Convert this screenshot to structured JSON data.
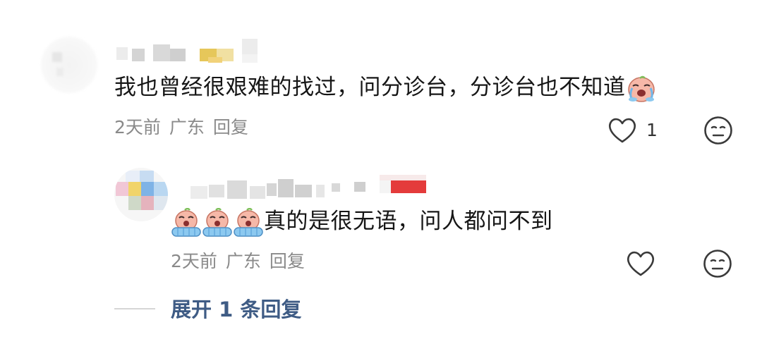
{
  "comments": [
    {
      "text": "我也曾经很艰难的找过，问分诊台，分诊台也不知道",
      "emoji_icon": "crying-baby-icon",
      "time": "2天前",
      "location": "广东",
      "reply_label": "回复",
      "like_count": "1"
    }
  ],
  "reply": {
    "emoji_icons": [
      "crying-baby-icon",
      "crying-baby-icon",
      "crying-baby-icon"
    ],
    "text": "真的是很无语，问人都问不到",
    "time": "2天前",
    "location": "广东",
    "reply_label": "回复"
  },
  "expand_replies_label": "展开 1 条回复",
  "colors": {
    "link": "#3f5c85",
    "meta": "#8a8a8a",
    "text": "#161616"
  }
}
